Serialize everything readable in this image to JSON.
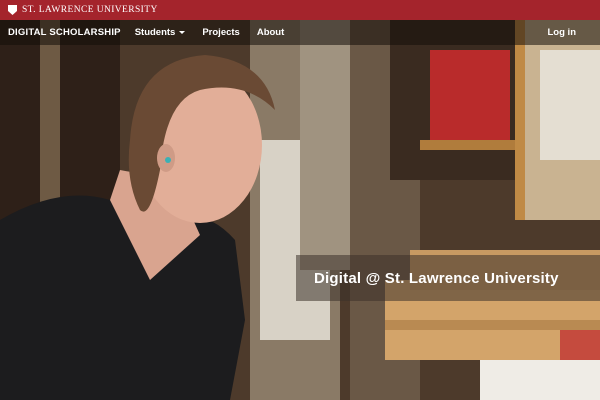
{
  "topbar": {
    "university_name": "ST. LAWRENCE UNIVERSITY",
    "logo_icon": "shield-icon",
    "color": "#a4242c"
  },
  "nav": {
    "brand": "DIGITAL SCHOLARSHIP",
    "items": [
      {
        "label": "Students",
        "icon": "chevron-down-icon"
      },
      {
        "label": "Projects"
      },
      {
        "label": "About"
      }
    ],
    "login": "Log in"
  },
  "hero": {
    "title": "Digital @ St. Lawrence University"
  }
}
